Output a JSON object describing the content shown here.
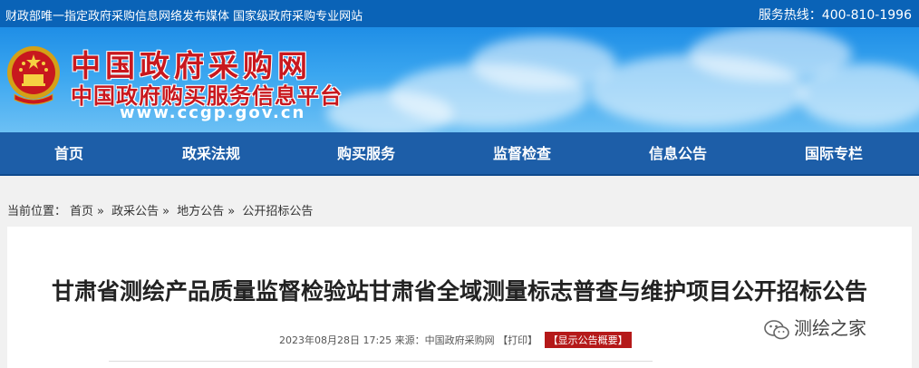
{
  "topbar": {
    "tagline": "财政部唯一指定政府采购信息网络发布媒体 国家级政府采购专业网站",
    "hotline": "服务热线：400-810-1996"
  },
  "banner": {
    "site_name": "中国政府采购网",
    "site_sub": "中国政府购买服务信息平台",
    "site_url": "www.ccgp.gov.cn"
  },
  "nav": {
    "items": [
      "首页",
      "政采法规",
      "购买服务",
      "监督检查",
      "信息公告",
      "国际专栏"
    ]
  },
  "breadcrumb": {
    "prefix": "当前位置：",
    "items": [
      "首页",
      "政采公告",
      "地方公告",
      "公开招标公告"
    ],
    "sep": "»"
  },
  "article": {
    "title": "甘肃省测绘产品质量监督检验站甘肃省全域测量标志普查与维护项目公开招标公告",
    "date": "2023年08月28日 17:25",
    "source": "来源：中国政府采购网",
    "print": "【打印】",
    "summary": "【显示公告概要】"
  },
  "watermark": {
    "text": "测绘之家",
    "icon": "wechat-icon"
  },
  "colors": {
    "topbar": "#0a63b7",
    "nav": "#1d5ea8",
    "brand_red": "#c8181e",
    "summary_bg": "#b51919"
  }
}
